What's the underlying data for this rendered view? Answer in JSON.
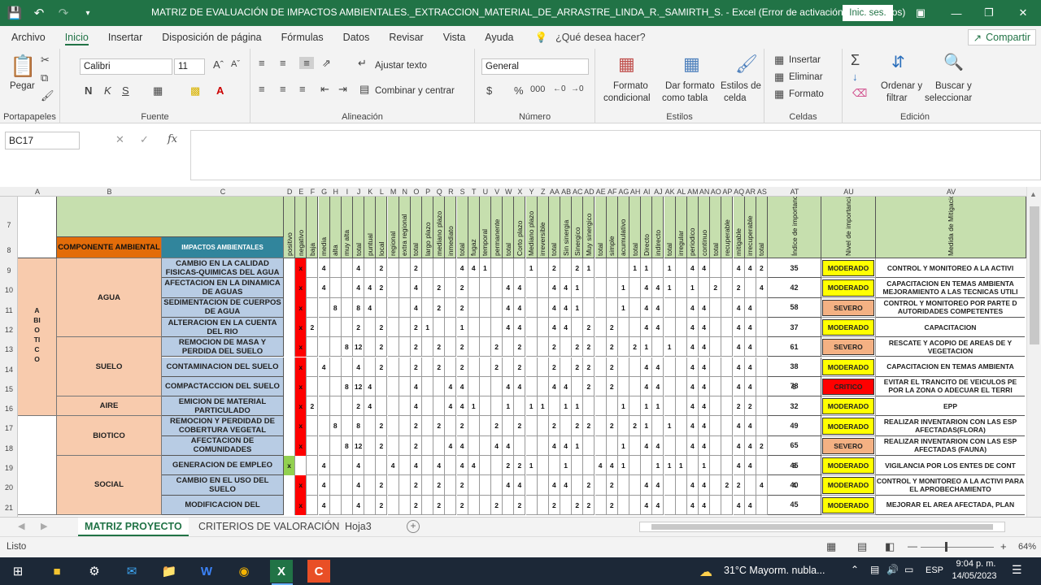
{
  "window": {
    "title": "MATRIZ  DE EVALUACIÓN DE IMPACTOS AMBIENTALES._EXTRACCION_MATERIAL_DE_ARRASTRE_LINDA_R._SAMIRTH_S.  -  Excel (Error de activación de productos)",
    "signin_label": "Inic. ses."
  },
  "menu": {
    "tabs": [
      "Archivo",
      "Inicio",
      "Insertar",
      "Disposición de página",
      "Fórmulas",
      "Datos",
      "Revisar",
      "Vista",
      "Ayuda"
    ],
    "active": "Inicio",
    "tell_me": "¿Qué desea hacer?",
    "share": "Compartir"
  },
  "ribbon": {
    "paste": "Pegar",
    "clipboard": "Portapapeles",
    "font_name": "Calibri",
    "font_size": "11",
    "font_group": "Fuente",
    "wrap_text": "Ajustar texto",
    "merge_center": "Combinar y centrar",
    "alignment_group": "Alineación",
    "number_format": "General",
    "number_group": "Número",
    "cond_format_1": "Formato",
    "cond_format_2": "condicional",
    "as_table_1": "Dar formato",
    "as_table_2": "como tabla",
    "cell_styles_1": "Estilos de",
    "cell_styles_2": "celda",
    "styles_group": "Estilos",
    "insert": "Insertar",
    "delete": "Eliminar",
    "format": "Formato",
    "cells_group": "Celdas",
    "sort_1": "Ordenar y",
    "sort_2": "filtrar",
    "find_1": "Buscar y",
    "find_2": "seleccionar",
    "editing_group": "Edición"
  },
  "formula_bar": {
    "name_box": "BC17",
    "formula": ""
  },
  "grid": {
    "col_headers": [
      "A",
      "B",
      "C",
      "D",
      "E",
      "F",
      "G",
      "H",
      "I",
      "J",
      "K",
      "L",
      "M",
      "N",
      "O",
      "P",
      "Q",
      "R",
      "S",
      "T",
      "U",
      "V",
      "W",
      "X",
      "Y",
      "Z",
      "AA",
      "AB",
      "AC",
      "AD",
      "AE",
      "AF",
      "AG",
      "AH",
      "AI",
      "AJ",
      "AK",
      "AL",
      "AM",
      "AN",
      "AO",
      "AP",
      "AQ",
      "AR",
      "AS",
      "AT",
      "AU",
      "AV",
      "AV"
    ],
    "row_headers": [
      "7",
      "8",
      "9",
      "10",
      "11",
      "12",
      "13",
      "14",
      "15",
      "16",
      "17",
      "18",
      "19",
      "20",
      "21"
    ],
    "sub_headers": [
      "positivo",
      "negativo",
      "baja",
      "media",
      "alta",
      "muy alta",
      "total",
      "puntual",
      "local",
      "regional",
      "extra regional",
      "total",
      "largo plazo",
      "mediano plazo",
      "inmediato",
      "total",
      "fugaz",
      "temporal",
      "permanente",
      "total",
      "Corto plazo",
      "Mediano plazo",
      "irreversible",
      "total",
      "Sin sinergia",
      "Sinergico",
      "Muy sinergico",
      "total",
      "simple",
      "acumulativo",
      "total",
      "Directo",
      "indirecto",
      "total",
      "irregular",
      "periodico",
      "continuo",
      "total",
      "recuperable",
      "mitigable",
      "irrecuperable",
      "total"
    ],
    "au_header": "Índice de importancia",
    "av_header": "Nivel de importancia",
    "measures_header": "Medida de Mitigación",
    "componente_header": "COMPONENTE AMBIENTAL",
    "impactos_header": "IMPACTOS AMBIENTALES",
    "abiotico_label": "ABIOTICO",
    "components": [
      "AGUA",
      "SUELO",
      "AIRE",
      "BIOTICO",
      "SOCIAL"
    ],
    "rows": [
      {
        "row": "9",
        "impacto": "CAMBIO EN LA CALIDAD FISICAS-QUIMICAS DEL AGUA",
        "d": "",
        "e": "x",
        "vals": [
          "",
          "4",
          "",
          "",
          "4",
          "",
          "2",
          "",
          "",
          "2",
          "",
          "",
          "",
          "4",
          "4",
          "1",
          "",
          "",
          "",
          "1",
          "",
          "2",
          "",
          "2",
          "1",
          "",
          "",
          "",
          "1",
          "1",
          "",
          "1",
          "",
          "4",
          "4",
          "",
          "",
          "4",
          "4",
          "2",
          "",
          "2"
        ],
        "au": "35",
        "av": "MODERADO",
        "medida": "CONTROL Y MONITOREO A LA ACTIVI"
      },
      {
        "row": "10",
        "impacto": "AFECTACION EN LA DINAMICA DE AGUAS",
        "d": "",
        "e": "x",
        "vals": [
          "",
          "4",
          "",
          "",
          "4",
          "4",
          "2",
          "",
          "",
          "4",
          "",
          "2",
          "",
          "2",
          "",
          "",
          "",
          "4",
          "4",
          "",
          "",
          "4",
          "4",
          "1",
          "",
          "",
          "",
          "1",
          "",
          "4",
          "4",
          "1",
          "",
          "1",
          "",
          "2",
          "",
          "2",
          "",
          "4",
          "",
          "4"
        ],
        "au": "42",
        "av": "MODERADO",
        "medida": "CAPACITACION EN TEMAS AMBIENTA MEJORAMIENTO A LAS TECNICAS UTILI"
      },
      {
        "row": "11",
        "impacto": "SEDIMENTACION DE CUERPOS DE AGUA",
        "d": "",
        "e": "x",
        "vals": [
          "",
          "",
          "8",
          "",
          "8",
          "4",
          "",
          "",
          "",
          "4",
          "",
          "2",
          "",
          "2",
          "",
          "",
          "",
          "4",
          "4",
          "",
          "",
          "4",
          "4",
          "1",
          "",
          "",
          "",
          "1",
          "",
          "4",
          "4",
          "",
          "",
          "4",
          "4",
          "",
          "",
          "4",
          "4",
          "",
          "",
          "4"
        ],
        "au": "58",
        "av": "SEVERO",
        "medida": "CONTROL Y MONITOREO POR PARTE D AUTORIDADES COMPETENTES"
      },
      {
        "row": "12",
        "impacto": "ALTERACION EN LA CUENTA DEL RIO",
        "d": "",
        "e": "x",
        "vals": [
          "2",
          "",
          "",
          "",
          "2",
          "",
          "2",
          "",
          "",
          "2",
          "1",
          "",
          "",
          "1",
          "",
          "",
          "",
          "4",
          "4",
          "",
          "",
          "4",
          "4",
          "",
          "2",
          "",
          "2",
          "",
          "",
          "4",
          "4",
          "",
          "",
          "4",
          "4",
          "",
          "",
          "4",
          "4",
          "",
          "",
          "4"
        ],
        "au": "37",
        "av": "MODERADO",
        "medida": "CAPACITACION"
      },
      {
        "row": "13",
        "impacto": "REMOCION DE MASA Y PERDIDA DEL SUELO",
        "d": "",
        "e": "x",
        "vals": [
          "",
          "",
          "",
          "8",
          "12",
          "",
          "2",
          "",
          "",
          "2",
          "",
          "2",
          "",
          "2",
          "",
          "",
          "2",
          "",
          "2",
          "",
          "",
          "2",
          "",
          "2",
          "2",
          "",
          "2",
          "",
          "2",
          "1",
          "",
          "1",
          "",
          "4",
          "4",
          "",
          "",
          "4",
          "4",
          "",
          "",
          "4"
        ],
        "au": "61",
        "av": "SEVERO",
        "medida": "RESCATE Y ACOPIO DE AREAS DE Y VEGETACION"
      },
      {
        "row": "14",
        "impacto": "CONTAMINACION DEL SUELO",
        "d": "",
        "e": "x",
        "vals": [
          "",
          "4",
          "",
          "",
          "4",
          "",
          "2",
          "",
          "",
          "2",
          "",
          "2",
          "",
          "2",
          "",
          "",
          "2",
          "",
          "2",
          "",
          "",
          "2",
          "",
          "2",
          "2",
          "",
          "2",
          "",
          "",
          "4",
          "4",
          "",
          "",
          "4",
          "4",
          "",
          "",
          "4",
          "4",
          "",
          "",
          "4"
        ],
        "au": "38",
        "av": "MODERADO",
        "medida": "CAPACITACION EN TEMAS AMBIENTA"
      },
      {
        "row": "15",
        "impacto": "COMPACTACCION DEL SUELO",
        "d": "",
        "e": "x",
        "vals": [
          "",
          "",
          "",
          "8",
          "12",
          "4",
          "",
          "",
          "",
          "4",
          "",
          "",
          "4",
          "4",
          "",
          "",
          "",
          "4",
          "4",
          "",
          "",
          "4",
          "4",
          "",
          "2",
          "",
          "2",
          "",
          "",
          "4",
          "4",
          "",
          "",
          "4",
          "4",
          "",
          "",
          "4",
          "4",
          "",
          "8",
          "8"
        ],
        "au": "78",
        "av": "CRITICO",
        "medida": "EVITAR EL TRANCITO DE VEICULOS PE POR LA ZONA O ADECUAR EL TERRI"
      },
      {
        "row": "16",
        "impacto": "EMICION DE MATERIAL PARTICULADO",
        "d": "",
        "e": "x",
        "vals": [
          "2",
          "",
          "",
          "",
          "2",
          "4",
          "",
          "",
          "",
          "4",
          "",
          "",
          "4",
          "4",
          "1",
          "",
          "",
          "1",
          "",
          "1",
          "1",
          "",
          "1",
          "1",
          "",
          "",
          "",
          "1",
          "",
          "1",
          "1",
          "",
          "",
          "4",
          "4",
          "",
          "",
          "2",
          "2",
          "",
          "",
          "4"
        ],
        "au": "32",
        "av": "MODERADO",
        "medida": "EPP"
      },
      {
        "row": "17",
        "impacto": "REMOCION Y PERDIDAD DE COBERTURA VEGETAL",
        "d": "",
        "e": "x",
        "vals": [
          "",
          "",
          "8",
          "",
          "8",
          "",
          "2",
          "",
          "",
          "2",
          "",
          "2",
          "",
          "2",
          "",
          "",
          "2",
          "",
          "2",
          "",
          "",
          "2",
          "",
          "2",
          "2",
          "",
          "2",
          "",
          "2",
          "1",
          "",
          "1",
          "",
          "4",
          "4",
          "",
          "",
          "4",
          "4",
          "",
          "",
          "4"
        ],
        "au": "49",
        "av": "MODERADO",
        "medida": "REALIZAR INVENTARION CON LAS ESP AFECTADAS(FLORA)"
      },
      {
        "row": "18",
        "impacto": "AFECTACION DE COMUNIDADES",
        "d": "",
        "e": "x",
        "vals": [
          "",
          "",
          "",
          "8",
          "12",
          "",
          "2",
          "",
          "",
          "2",
          "",
          "",
          "4",
          "4",
          "",
          "",
          "4",
          "4",
          "",
          "",
          "",
          "4",
          "4",
          "1",
          "",
          "",
          "",
          "1",
          "",
          "4",
          "4",
          "",
          "",
          "4",
          "4",
          "",
          "",
          "4",
          "4",
          "2",
          "",
          "2"
        ],
        "au": "65",
        "av": "SEVERO",
        "medida": "REALIZAR INVENTARION CON LAS ESP AFECTADAS (FAUNA)"
      },
      {
        "row": "19",
        "impacto": "GENERACION DE EMPLEO",
        "d": "x",
        "e": "",
        "vals": [
          "",
          "4",
          "",
          "",
          "4",
          "",
          "",
          "4",
          "",
          "4",
          "",
          "4",
          "",
          "4",
          "4",
          "",
          "",
          "2",
          "2",
          "1",
          "",
          "",
          "1",
          "",
          "",
          "4",
          "4",
          "1",
          "",
          "",
          "1",
          "1",
          "1",
          "",
          "1",
          "",
          "",
          "4",
          "4",
          "",
          "8",
          "8"
        ],
        "au": "45",
        "av": "MODERADO",
        "medida": "VIGILANCIA POR LOS ENTES DE CONT"
      },
      {
        "row": "20",
        "impacto": "CAMBIO EN EL USO DEL SUELO",
        "d": "",
        "e": "x",
        "vals": [
          "",
          "4",
          "",
          "",
          "4",
          "",
          "2",
          "",
          "",
          "2",
          "",
          "2",
          "",
          "2",
          "",
          "",
          "",
          "4",
          "4",
          "",
          "",
          "4",
          "4",
          "",
          "2",
          "",
          "2",
          "",
          "",
          "4",
          "4",
          "",
          "",
          "4",
          "4",
          "",
          "2",
          "2",
          "",
          "4",
          "4",
          ""
        ],
        "au": "40",
        "av": "MODERADO",
        "medida": "CONTROL Y MONITOREO A LA ACTIVI PARA EL APROBECHAMIENTO"
      },
      {
        "row": "21",
        "impacto": "MODIFICACION DEL",
        "d": "",
        "e": "x",
        "vals": [
          "",
          "4",
          "",
          "",
          "4",
          "",
          "2",
          "",
          "",
          "2",
          "",
          "2",
          "",
          "2",
          "",
          "",
          "2",
          "",
          "2",
          "",
          "",
          "2",
          "",
          "2",
          "2",
          "",
          "2",
          "",
          "",
          "4",
          "4",
          "",
          "",
          "4",
          "4",
          "",
          "",
          "4",
          "4",
          "",
          "",
          "4"
        ],
        "au": "45",
        "av": "MODERADO",
        "medida": "MEJORAR EL AREA AFECTADA, PLAN"
      }
    ]
  },
  "sheets": {
    "tabs": [
      "MATRIZ PROYECTO",
      "CRITERIOS DE VALORACIÓN",
      "Hoja3"
    ],
    "active": "MATRIZ PROYECTO"
  },
  "status": {
    "ready": "Listo",
    "zoom": "64%"
  },
  "taskbar": {
    "weather": "31°C  Mayorm. nubla...",
    "lang": "ESP",
    "time": "9:04 p. m.",
    "date": "14/05/2023"
  },
  "colors": {
    "excel_green": "#217346",
    "moderado": "#ffff00",
    "severo": "#f4b183",
    "critico": "#ff0000",
    "abiotico": "#f8cbad",
    "impactos": "#b8cce4",
    "header_green": "#c6dfae",
    "negativo_red": "#ff0000",
    "positivo_green": "#92d050"
  }
}
